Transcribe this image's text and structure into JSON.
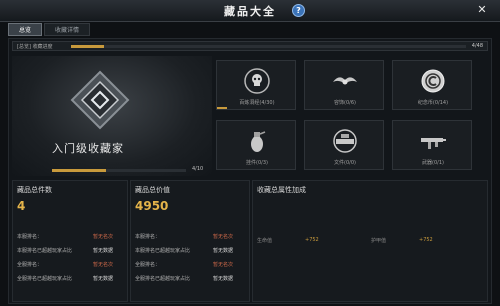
{
  "window": {
    "title": "藏品大全",
    "help_label": "?",
    "close_label": "✕"
  },
  "tabs": [
    {
      "label": "总览",
      "active": true
    },
    {
      "label": "收藏详情",
      "active": false
    }
  ],
  "overall_progress": {
    "label": "[总览] 收藏进度",
    "count": "4/48",
    "fraction": 0.0833
  },
  "collector": {
    "title": "入门级收藏家",
    "count": "4/10",
    "fraction": 0.4
  },
  "categories": [
    {
      "label": "百炼洞经(4/30)",
      "icon": "skull-badge-icon",
      "fraction": 0.133
    },
    {
      "label": "容饰(0/6)",
      "icon": "wings-emblem-icon",
      "fraction": 0
    },
    {
      "label": "纪念币(0/14)",
      "icon": "coin-icon",
      "fraction": 0
    },
    {
      "label": "挂件(0/3)",
      "icon": "grenade-icon",
      "fraction": 0
    },
    {
      "label": "文件(0/0)",
      "icon": "document-emblem-icon",
      "fraction": 0
    },
    {
      "label": "武器(0/1)",
      "icon": "rifle-icon",
      "fraction": 0
    }
  ],
  "total_count": {
    "header": "藏品总件数",
    "value": "4",
    "rows": [
      {
        "label": "本服排名：",
        "value": "暂无名次",
        "tone": "red"
      },
      {
        "label": "本服排名已超越玩家占比",
        "value": "暂无数据",
        "tone": "white"
      },
      {
        "label": "全服排名：",
        "value": "暂无名次",
        "tone": "red"
      },
      {
        "label": "全服排名已超越玩家占比",
        "value": "暂无数据",
        "tone": "white"
      }
    ]
  },
  "total_value": {
    "header": "藏品总价值",
    "value": "4950",
    "rows": [
      {
        "label": "本服排名：",
        "value": "暂无名次",
        "tone": "red"
      },
      {
        "label": "本服排名已超越玩家占比",
        "value": "暂无数据",
        "tone": "white"
      },
      {
        "label": "全服排名：",
        "value": "暂无名次",
        "tone": "red"
      },
      {
        "label": "全服排名已超越玩家占比",
        "value": "暂无数据",
        "tone": "white"
      }
    ]
  },
  "attributes": {
    "title": "收藏总属性加成",
    "items": [
      {
        "name": "生命值",
        "value": "+752"
      },
      {
        "name": "护甲值",
        "value": "+752"
      }
    ]
  },
  "colors": {
    "accent": "#c89a3c",
    "rank_red": "#d06a4a",
    "big_number": "#e4b44a"
  }
}
